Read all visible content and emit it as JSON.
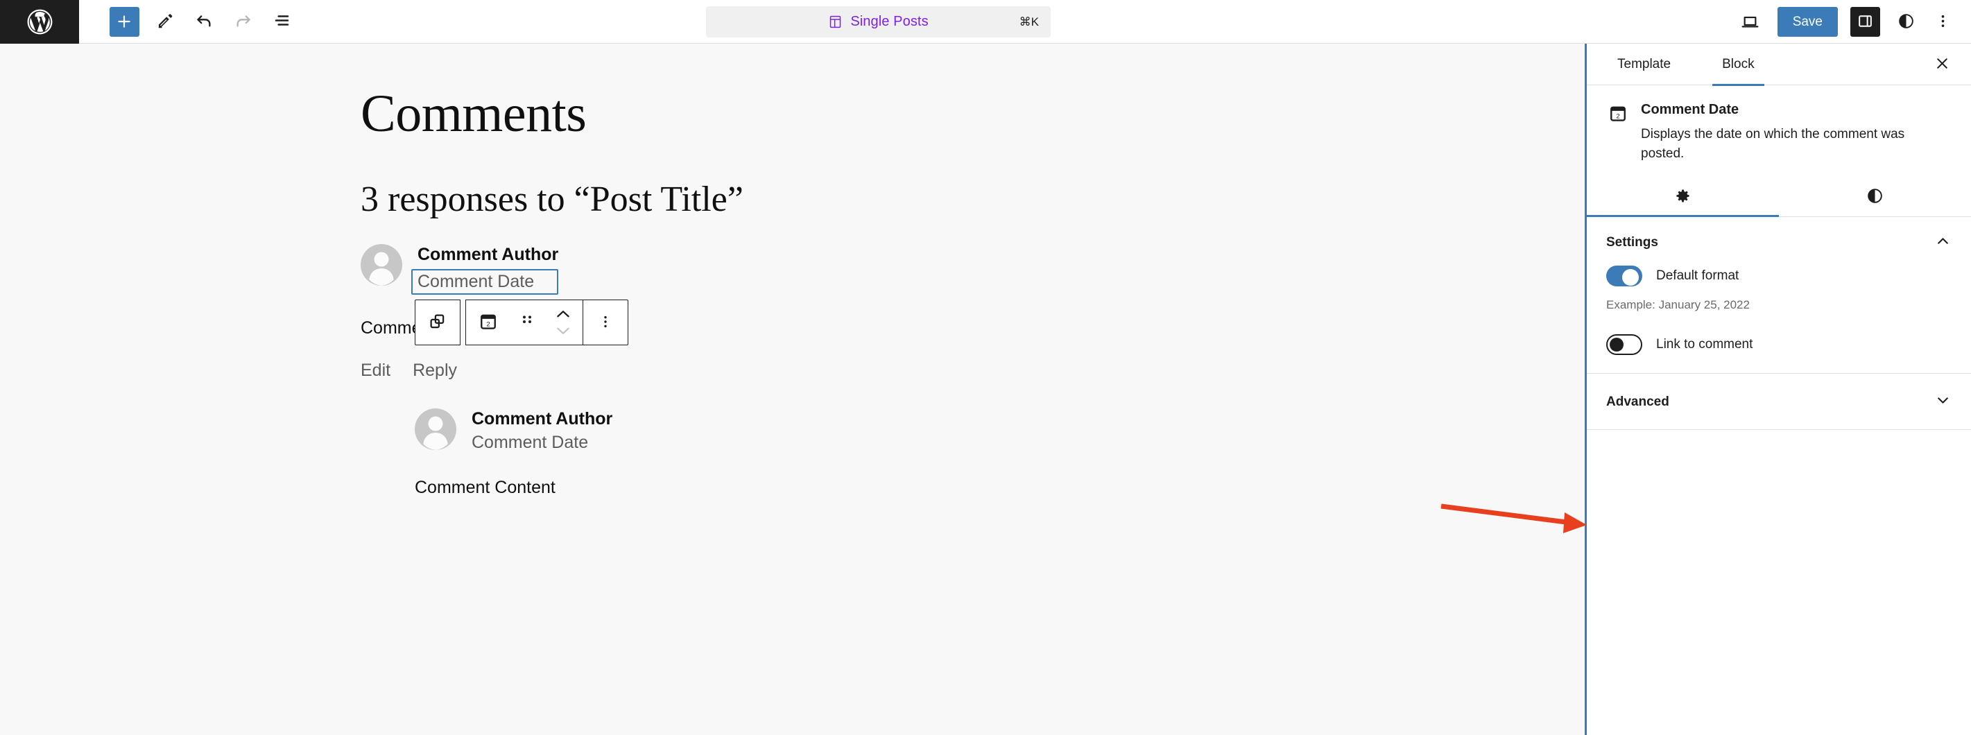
{
  "header": {
    "logo_label": "WordPress",
    "add_block_label": "Add block",
    "tools_label": "Tools",
    "undo_label": "Undo",
    "redo_label": "Redo",
    "list_view_label": "Document Overview",
    "command_bar": {
      "title": "Single Posts",
      "shortcut": "⌘K",
      "icon": "template-icon"
    },
    "view_label": "View",
    "save_label": "Save",
    "settings_toggle_label": "Settings",
    "styles_label": "Styles",
    "options_label": "Options"
  },
  "canvas": {
    "title": "Comments",
    "responses_heading": "3 responses to “Post Title”",
    "comments": [
      {
        "author": "Comment Author",
        "date": "Comment Date",
        "content": "Comment Content",
        "actions": [
          "Edit",
          "Reply"
        ]
      },
      {
        "author": "Comment Author",
        "date": "Comment Date",
        "content": "Comment Content",
        "actions": []
      }
    ]
  },
  "block_toolbar": {
    "select_parent_label": "Select parent block: Comment Author Name",
    "block_type_label": "Comment Date",
    "drag_label": "Drag",
    "move_up_label": "Move up",
    "move_down_label": "Move down",
    "more_options_label": "Options"
  },
  "sidebar": {
    "tabs": [
      {
        "label": "Template",
        "active": false
      },
      {
        "label": "Block",
        "active": true
      }
    ],
    "close_label": "Close Settings",
    "block_card": {
      "title": "Comment Date",
      "description": "Displays the date on which the comment was posted.",
      "icon": "calendar-date-icon"
    },
    "icon_tabs": [
      {
        "name": "settings-gear-icon",
        "active": true
      },
      {
        "name": "styles-contrast-icon",
        "active": false
      }
    ],
    "panels": [
      {
        "title": "Settings",
        "expanded": true,
        "controls": [
          {
            "type": "toggle",
            "label": "Default format",
            "value": true,
            "help": "Example: January 25, 2022"
          },
          {
            "type": "toggle",
            "label": "Link to comment",
            "value": false,
            "help": ""
          }
        ]
      },
      {
        "title": "Advanced",
        "expanded": false,
        "controls": []
      }
    ]
  },
  "annotation": {
    "type": "arrow",
    "color": "#e8401f",
    "points_to": "link-to-comment-toggle"
  },
  "colors": {
    "accent_blue": "#3b7cb8",
    "command_purple": "#7f20e8",
    "dark": "#1e1e1e",
    "canvas_bg": "#f8f8f8",
    "annotation_red": "#e8401f"
  }
}
